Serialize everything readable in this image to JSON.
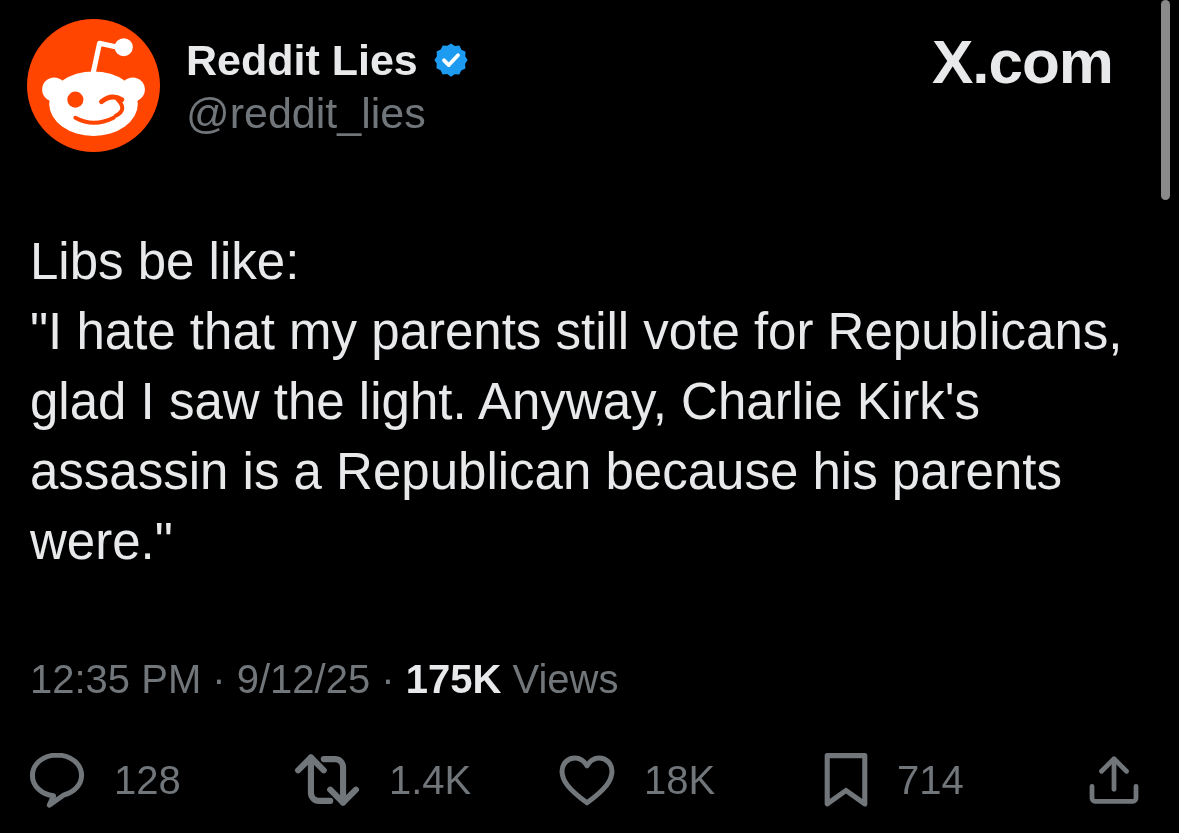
{
  "account": {
    "display_name": "Reddit Lies",
    "verified": true,
    "handle": "@reddit_lies"
  },
  "brand": {
    "label": "X.com"
  },
  "post": {
    "text": "Libs be like:\n\"I hate that my parents still vote for Republicans, glad I saw the light. Anyway, Charlie Kirk's assassin is a Republican because his parents were.\"",
    "meta": "12:35 PM · 9/12/25 · **175K** Views"
  },
  "actions": [
    {
      "kind": "reply",
      "count": "128"
    },
    {
      "kind": "repost",
      "count": "1.4K"
    },
    {
      "kind": "like",
      "count": "18K"
    },
    {
      "kind": "bookmark",
      "count": "714"
    },
    {
      "kind": "share"
    }
  ]
}
